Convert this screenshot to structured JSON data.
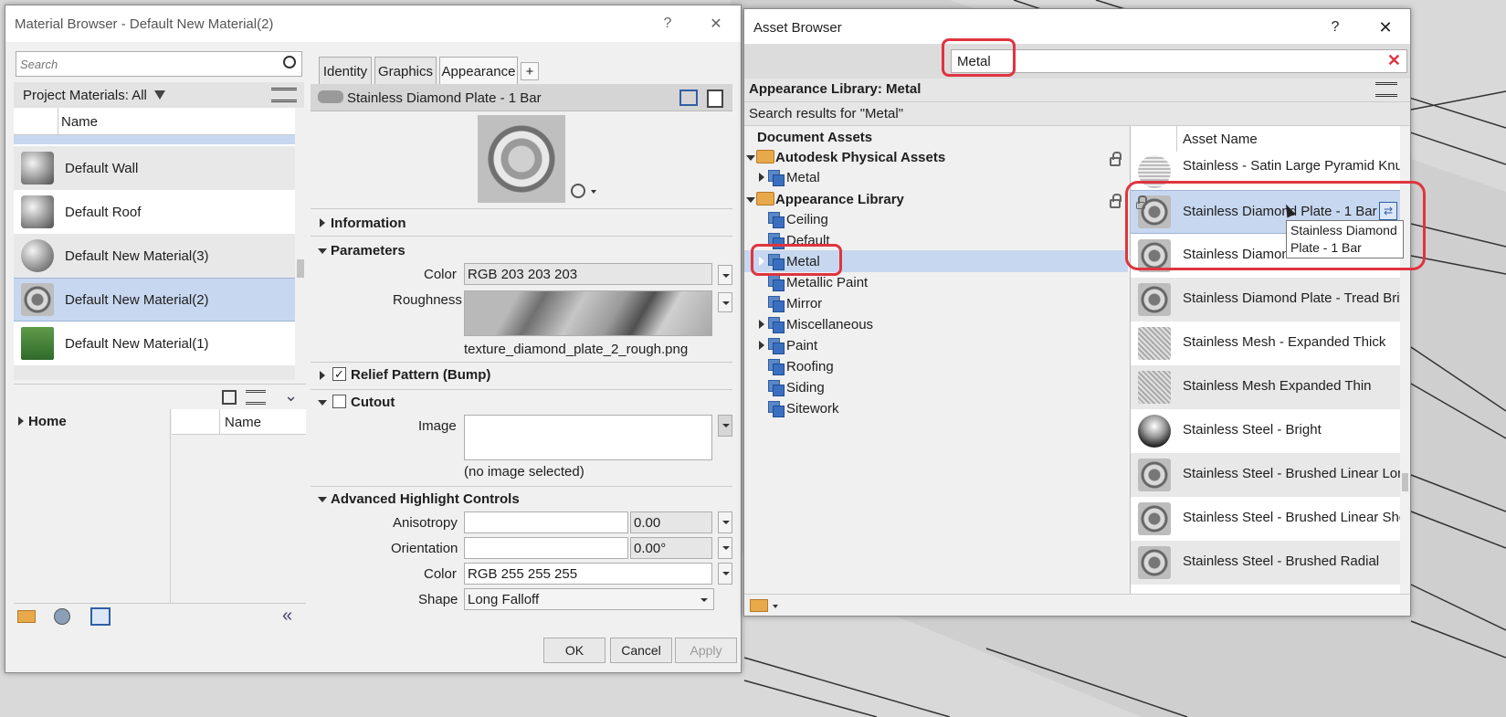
{
  "material_browser": {
    "title": "Material Browser - Default New Material(2)",
    "help": "?",
    "close": "✕",
    "search_placeholder": "Search",
    "project_materials_label": "Project Materials: All",
    "name_header": "Name",
    "materials": [
      {
        "name": "Default Wall"
      },
      {
        "name": "Default Roof"
      },
      {
        "name": "Default New Material(3)"
      },
      {
        "name": "Default New Material(2)"
      },
      {
        "name": "Default New Material(1)"
      }
    ],
    "home_label": "Home",
    "library_name_header": "Name",
    "tabs": [
      "Identity",
      "Graphics",
      "Appearance"
    ],
    "add_tab": "+",
    "asset_title": "Stainless Diamond Plate - 1 Bar",
    "sections": {
      "information": "Information",
      "parameters": "Parameters",
      "relief": "Relief Pattern (Bump)",
      "cutout": "Cutout",
      "advanced": "Advanced Highlight Controls"
    },
    "params": {
      "color_label": "Color",
      "color_value": "RGB 203 203 203",
      "roughness_label": "Roughness",
      "roughness_file": "texture_diamond_plate_2_rough.png",
      "image_label": "Image",
      "image_status": "(no image selected)"
    },
    "advanced": {
      "anisotropy_label": "Anisotropy",
      "anisotropy_value": "0.00",
      "orientation_label": "Orientation",
      "orientation_value": "0.00°",
      "color_label": "Color",
      "color_value": "RGB 255 255 255",
      "shape_label": "Shape",
      "shape_value": "Long Falloff"
    },
    "relief_checked": true,
    "cutout_checked": false,
    "buttons": {
      "ok": "OK",
      "cancel": "Cancel",
      "apply": "Apply"
    }
  },
  "asset_browser": {
    "title": "Asset Browser",
    "help": "?",
    "close": "✕",
    "search_value": "Metal",
    "library_header": "Appearance Library: Metal",
    "search_results": "Search results for \"Metal\"",
    "tree_header": "Document Assets",
    "tree": [
      {
        "label": "Autodesk Physical Assets",
        "type": "folder",
        "level": 0
      },
      {
        "label": "Metal",
        "type": "item",
        "level": 1
      },
      {
        "label": "Appearance Library",
        "type": "folder",
        "level": 0
      },
      {
        "label": "Ceiling",
        "type": "item",
        "level": 1
      },
      {
        "label": "Default",
        "type": "item",
        "level": 1
      },
      {
        "label": "Metal",
        "type": "item",
        "level": 1,
        "selected": true
      },
      {
        "label": "Metallic Paint",
        "type": "item",
        "level": 1
      },
      {
        "label": "Mirror",
        "type": "item",
        "level": 1
      },
      {
        "label": "Miscellaneous",
        "type": "item",
        "level": 1
      },
      {
        "label": "Paint",
        "type": "item",
        "level": 1
      },
      {
        "label": "Roofing",
        "type": "item",
        "level": 1
      },
      {
        "label": "Siding",
        "type": "item",
        "level": 1
      },
      {
        "label": "Sitework",
        "type": "item",
        "level": 1
      }
    ],
    "asset_name_header": "Asset Name",
    "assets": [
      {
        "name": "Stainless - Satin Large Pyramid Knurl"
      },
      {
        "name": "Stainless Diamond Plate - 1 Bar",
        "selected": true
      },
      {
        "name": "Stainless Diamond"
      },
      {
        "name": "Stainless Diamond Plate - Tread Brite"
      },
      {
        "name": "Stainless Mesh - Expanded Thick"
      },
      {
        "name": "Stainless Mesh Expanded Thin"
      },
      {
        "name": "Stainless Steel - Bright"
      },
      {
        "name": "Stainless Steel - Brushed Linear Long"
      },
      {
        "name": "Stainless Steel - Brushed Linear Short"
      },
      {
        "name": "Stainless Steel - Brushed Radial"
      }
    ],
    "tooltip_line1": "Stainless Diamond",
    "tooltip_line2": "Plate - 1 Bar"
  },
  "colors": {
    "highlight": "#c7d7ef",
    "annotation_red": "#e0343f"
  }
}
